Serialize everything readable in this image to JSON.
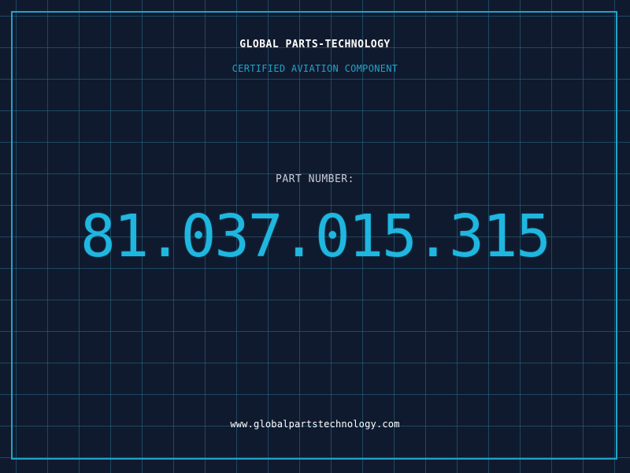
{
  "header": {
    "brand": "GLOBAL PARTS-TECHNOLOGY",
    "tagline": "CERTIFIED AVIATION COMPONENT"
  },
  "part": {
    "label": "PART NUMBER:",
    "number": "81.037.015.315"
  },
  "footer": {
    "website": "www.globalpartstechnology.com"
  },
  "colors": {
    "background": "#101a2e",
    "accent": "#1fa3c9",
    "part_number": "#1fb7e0",
    "text": "#ffffff"
  }
}
